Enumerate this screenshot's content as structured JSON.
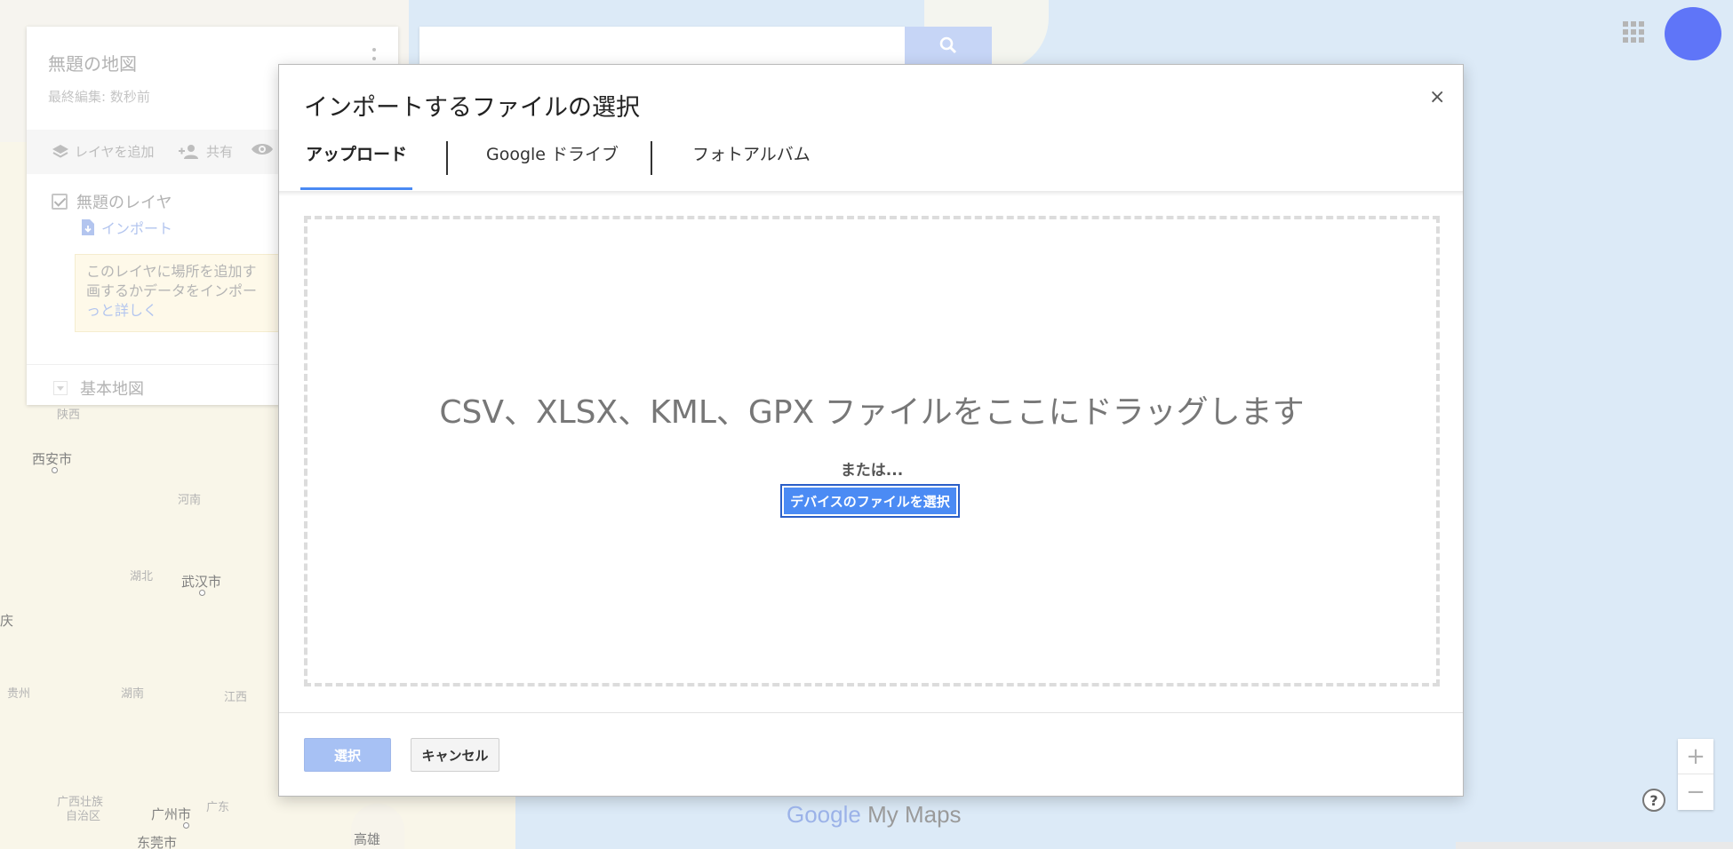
{
  "map": {
    "cities": [
      {
        "name": "陕西"
      },
      {
        "name": "西安市"
      },
      {
        "name": "河南"
      },
      {
        "name": "湖北"
      },
      {
        "name": "武汉市"
      },
      {
        "name": "庆"
      },
      {
        "name": "贵州"
      },
      {
        "name": "湖南"
      },
      {
        "name": "江西"
      },
      {
        "name": "广西壮族"
      },
      {
        "name": "自治区"
      },
      {
        "name": "广州市"
      },
      {
        "name": "广东"
      },
      {
        "name": "东莞市"
      },
      {
        "name": "高雄"
      }
    ]
  },
  "header": {
    "apps_icon": "apps-grid-icon",
    "avatar_color": "#0a2cf5"
  },
  "panel": {
    "title": "無題の地図",
    "subtitle": "最終編集: 数秒前",
    "tools": {
      "add_layer": "レイヤを追加",
      "share": "共有"
    },
    "layer": {
      "name": "無題のレイヤ",
      "import": "インポート",
      "tip_line1": "このレイヤに場所を追加す",
      "tip_line2": "画するかデータをインポー",
      "tip_link": "っと詳しく"
    },
    "base_map": "基本地図"
  },
  "search": {
    "placeholder": ""
  },
  "dialog": {
    "title": "インポートするファイルの選択",
    "close": "×",
    "tabs": [
      {
        "label": "アップロード",
        "active": true
      },
      {
        "label": "Google ドライブ",
        "active": false
      },
      {
        "label": "フォトアルバム",
        "active": false
      }
    ],
    "drop_text": "CSV、XLSX、KML、GPX ファイルをここにドラッグします",
    "or_text": "または...",
    "device_button": "デバイスのファイルを選択",
    "select_button": "選択",
    "cancel_button": "キャンセル"
  },
  "brand": {
    "google": "Google",
    "product": " My Maps"
  },
  "controls": {
    "zoom_in": "+",
    "zoom_out": "−",
    "help": "?"
  },
  "colors": {
    "accent": "#4b8bf4",
    "select_disabled": "#a7c1f4",
    "tip_bg": "#fdf6dd"
  }
}
